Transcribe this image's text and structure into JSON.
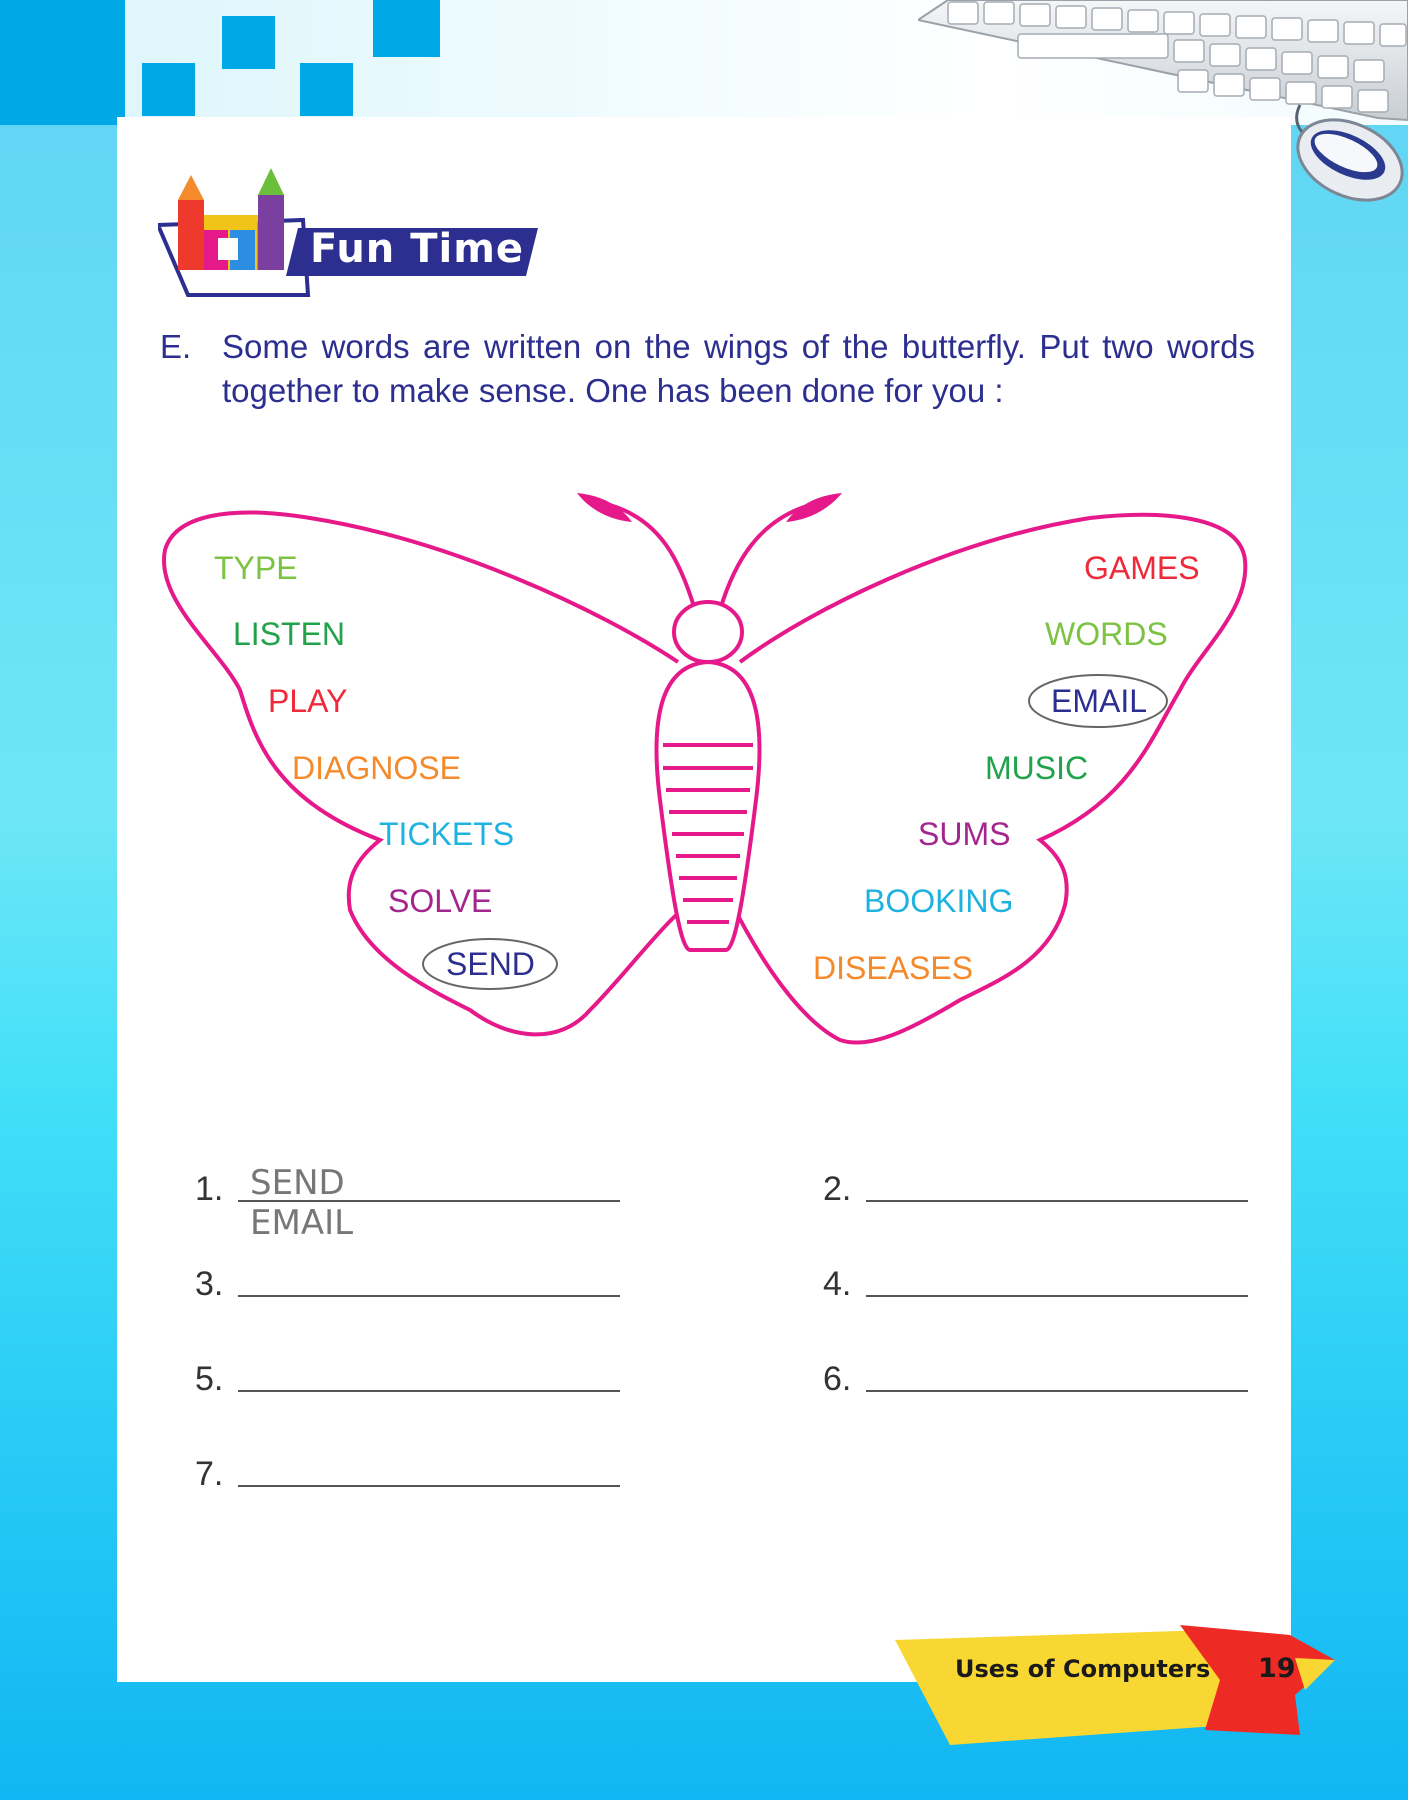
{
  "section_title": "Fun Time",
  "exercise": {
    "letter": "E.",
    "instruction": "Some words are written on the wings of the butterfly. Put two words together to make sense. One has been done for you :"
  },
  "left_wing_words": [
    {
      "text": "TYPE",
      "color": "#7cc243"
    },
    {
      "text": "LISTEN",
      "color": "#21a24b"
    },
    {
      "text": "PLAY",
      "color": "#ee2a3a"
    },
    {
      "text": "DIAGNOSE",
      "color": "#f58a2d"
    },
    {
      "text": "TICKETS",
      "color": "#1eb2e0"
    },
    {
      "text": "SOLVE",
      "color": "#a3268f"
    },
    {
      "text": "SEND",
      "color": "#2c2f8f"
    }
  ],
  "right_wing_words": [
    {
      "text": "GAMES",
      "color": "#ee2a3a"
    },
    {
      "text": "WORDS",
      "color": "#7cc243"
    },
    {
      "text": "EMAIL",
      "color": "#2c2f8f"
    },
    {
      "text": "MUSIC",
      "color": "#21a24b"
    },
    {
      "text": "SUMS",
      "color": "#a3268f"
    },
    {
      "text": "BOOKING",
      "color": "#1eb2e0"
    },
    {
      "text": "DISEASES",
      "color": "#f58a2d"
    }
  ],
  "answers": [
    {
      "num": "1.",
      "value": "SEND EMAIL"
    },
    {
      "num": "2.",
      "value": ""
    },
    {
      "num": "3.",
      "value": ""
    },
    {
      "num": "4.",
      "value": ""
    },
    {
      "num": "5.",
      "value": ""
    },
    {
      "num": "6.",
      "value": ""
    },
    {
      "num": "7.",
      "value": ""
    }
  ],
  "footer": {
    "chapter": "Uses of Computers",
    "page": "19"
  },
  "colors": {
    "butterfly_outline": "#e6198a",
    "heading_navy": "#2c2f8f",
    "corner_squares": "#00a8e6",
    "footer_yellow": "#f8d732",
    "footer_red": "#ee2a24"
  }
}
